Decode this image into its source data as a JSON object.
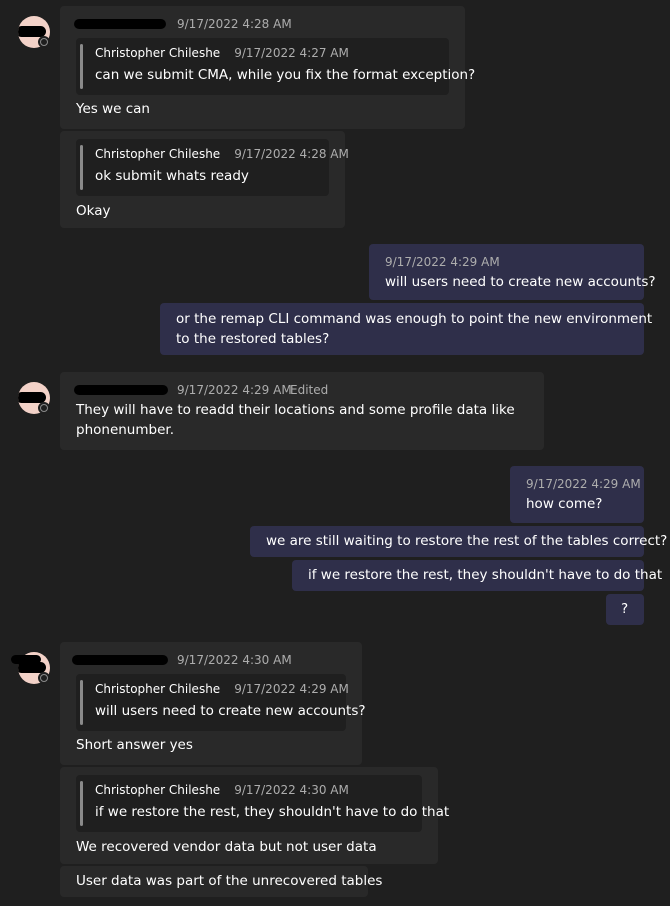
{
  "theme": {
    "background": "#1f1f1f",
    "bubble_other": "#292929",
    "bubble_self": "#2f2f4a",
    "meta_text": "#adadad"
  },
  "groups": [
    {
      "header": {
        "time": "9/17/2022 4:28 AM"
      },
      "messages": [
        {
          "quote": {
            "author": "Christopher Chileshe",
            "time": "9/17/2022 4:27 AM",
            "text": "can we submit CMA, while you fix the format exception?"
          },
          "text": "Yes we can"
        },
        {
          "quote": {
            "author": "Christopher Chileshe",
            "time": "9/17/2022 4:28 AM",
            "text": "ok submit whats ready"
          },
          "text": "Okay"
        }
      ]
    },
    {
      "self": true,
      "header": {
        "time": "9/17/2022 4:29 AM"
      },
      "messages": [
        {
          "text": "will users need to create new accounts?"
        },
        {
          "lines": [
            "or the remap CLI command was enough to point the new environment",
            "to the restored tables?"
          ]
        }
      ]
    },
    {
      "header": {
        "time": "9/17/2022 4:29 AM",
        "edited": "Edited"
      },
      "messages": [
        {
          "lines": [
            "They will have to readd their locations and some profile data like",
            "phonenumber."
          ]
        }
      ]
    },
    {
      "self": true,
      "header": {
        "time": "9/17/2022 4:29 AM"
      },
      "messages": [
        {
          "text": "how come?"
        },
        {
          "text": "we are still waiting to restore the rest of the tables correct?"
        },
        {
          "text": "if we restore the rest, they shouldn't have to do that"
        },
        {
          "text": "?"
        }
      ]
    },
    {
      "header": {
        "time": "9/17/2022 4:30 AM"
      },
      "messages": [
        {
          "quote": {
            "author": "Christopher Chileshe",
            "time": "9/17/2022 4:29 AM",
            "text": "will users need to create new accounts?"
          },
          "text": "Short answer yes"
        },
        {
          "quote": {
            "author": "Christopher Chileshe",
            "time": "9/17/2022 4:30 AM",
            "text": "if we restore the rest, they shouldn't have to do that"
          },
          "text": "We recovered vendor data but not user data"
        },
        {
          "text": "User data was part of the unrecovered tables"
        }
      ]
    }
  ]
}
